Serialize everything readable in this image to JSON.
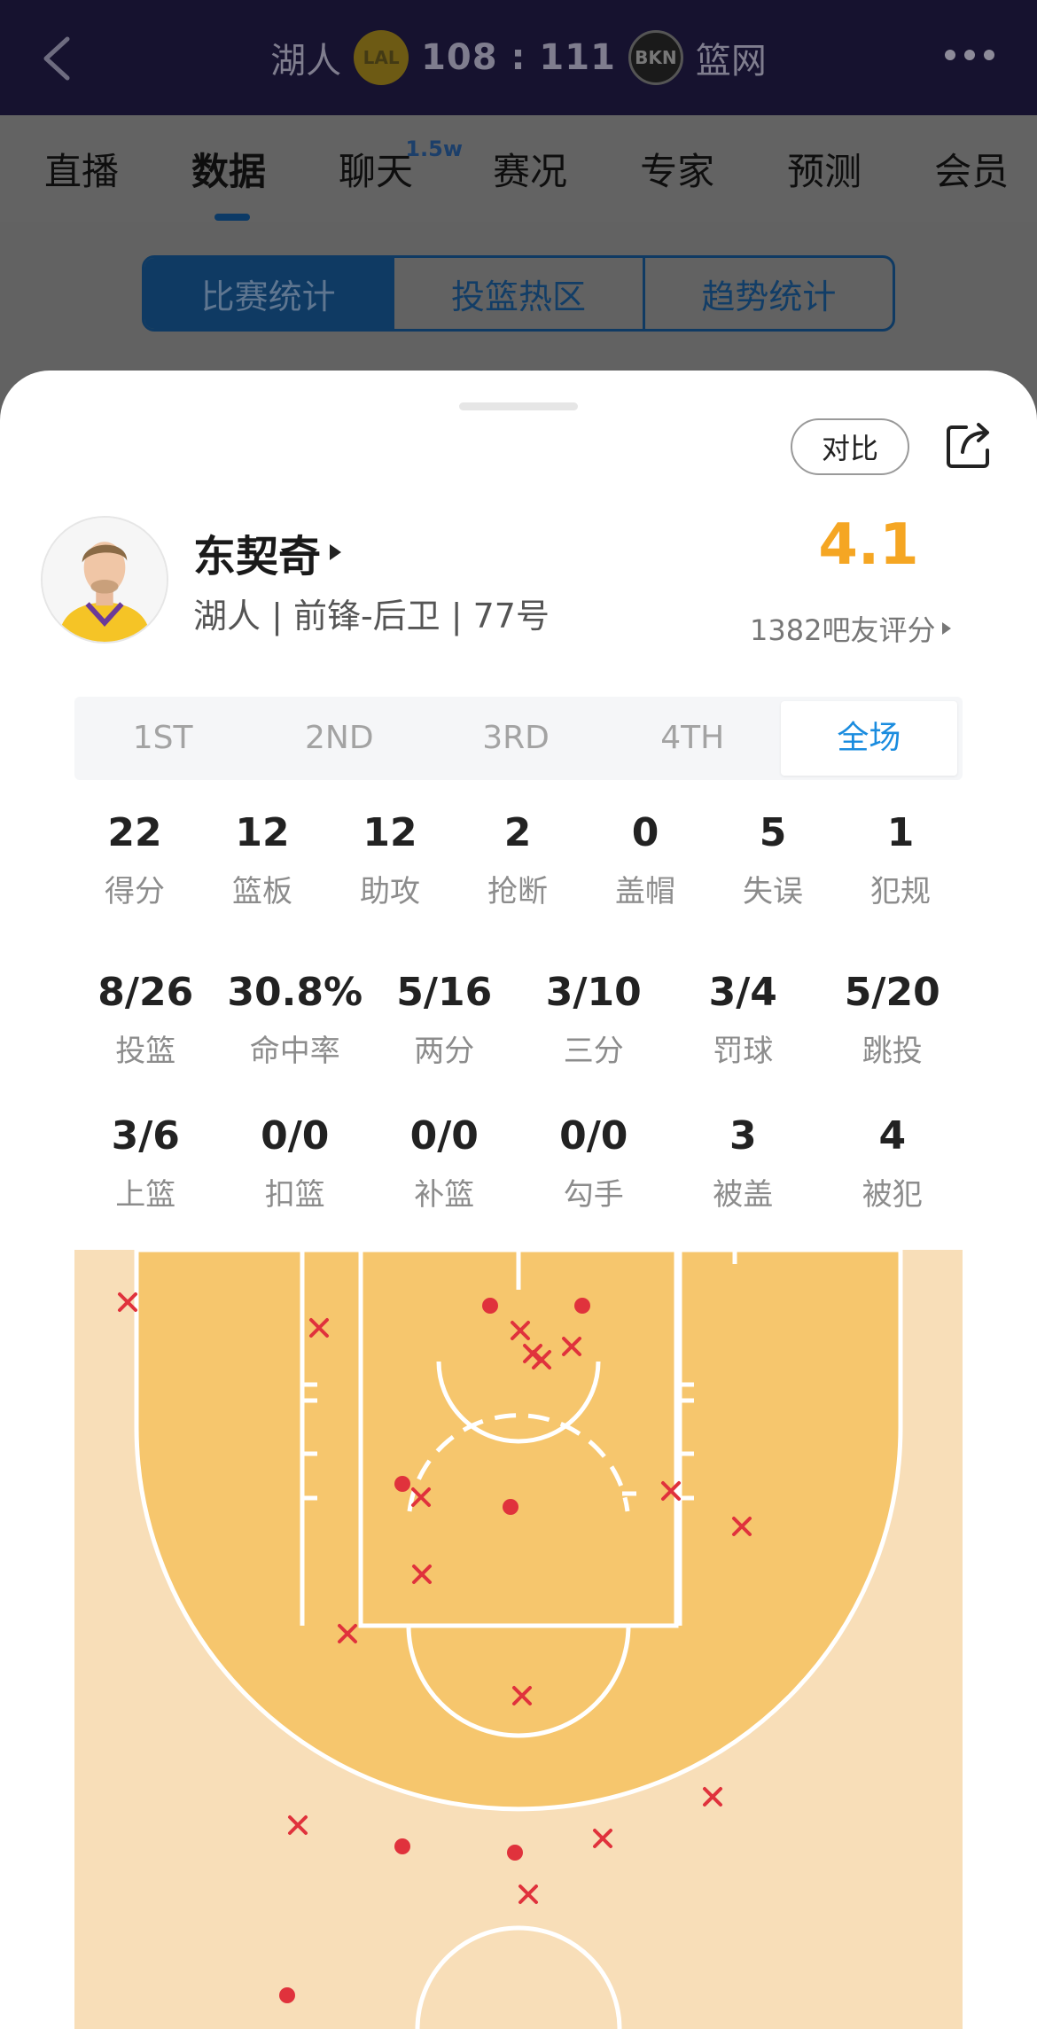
{
  "header": {
    "home_team": "湖人",
    "home_logo_text": "LAL",
    "score": "108 : 111",
    "away_logo_text": "BKN",
    "away_team": "篮网"
  },
  "tabs": [
    {
      "label": "直播"
    },
    {
      "label": "数据"
    },
    {
      "label": "聊天",
      "badge": "1.5w"
    },
    {
      "label": "赛况"
    },
    {
      "label": "专家"
    },
    {
      "label": "预测"
    },
    {
      "label": "会员"
    }
  ],
  "segments": [
    "比赛统计",
    "投篮热区",
    "趋势统计"
  ],
  "player": {
    "compare_label": "对比",
    "name": "东契奇",
    "info": "湖人 | 前锋-后卫 | 77号",
    "rating": "4.1",
    "raters": "1382吧友评分"
  },
  "periods": [
    "1ST",
    "2ND",
    "3RD",
    "4TH",
    "全场"
  ],
  "stats_row1": [
    {
      "value": "22",
      "label": "得分"
    },
    {
      "value": "12",
      "label": "篮板"
    },
    {
      "value": "12",
      "label": "助攻"
    },
    {
      "value": "2",
      "label": "抢断"
    },
    {
      "value": "0",
      "label": "盖帽"
    },
    {
      "value": "5",
      "label": "失误"
    },
    {
      "value": "1",
      "label": "犯规"
    }
  ],
  "stats_row2": [
    {
      "value": "8/26",
      "label": "投篮"
    },
    {
      "value": "30.8%",
      "label": "命中率"
    },
    {
      "value": "5/16",
      "label": "两分"
    },
    {
      "value": "3/10",
      "label": "三分"
    },
    {
      "value": "3/4",
      "label": "罚球"
    },
    {
      "value": "5/20",
      "label": "跳投"
    }
  ],
  "stats_row3": [
    {
      "value": "3/6",
      "label": "上篮"
    },
    {
      "value": "0/0",
      "label": "扣篮"
    },
    {
      "value": "0/0",
      "label": "补篮"
    },
    {
      "value": "0/0",
      "label": "勾手"
    },
    {
      "value": "3",
      "label": "被盖"
    },
    {
      "value": "4",
      "label": "被犯"
    }
  ],
  "colors": {
    "accent_blue": "#1a8cdf",
    "rating_orange": "#f5a623",
    "court_inner": "#f6c66d",
    "court_outer": "#f8deb8",
    "made_shot": "#e0323c",
    "missed_shot": "#e0323c"
  },
  "shot_chart": {
    "made": [
      [
        -32,
        63
      ],
      [
        72,
        63
      ],
      [
        -131,
        264
      ],
      [
        -9,
        290
      ],
      [
        -131,
        673
      ],
      [
        -4,
        680
      ],
      [
        -261,
        841
      ]
    ],
    "missed": [
      [
        -441,
        59
      ],
      [
        -225,
        88
      ],
      [
        2,
        91
      ],
      [
        16,
        117
      ],
      [
        26,
        124
      ],
      [
        60,
        109
      ],
      [
        -110,
        279
      ],
      [
        172,
        272
      ],
      [
        252,
        312
      ],
      [
        -109,
        366
      ],
      [
        -193,
        433
      ],
      [
        4,
        503
      ],
      [
        -249,
        649
      ],
      [
        219,
        617
      ],
      [
        95,
        664
      ],
      [
        11,
        727
      ]
    ]
  }
}
